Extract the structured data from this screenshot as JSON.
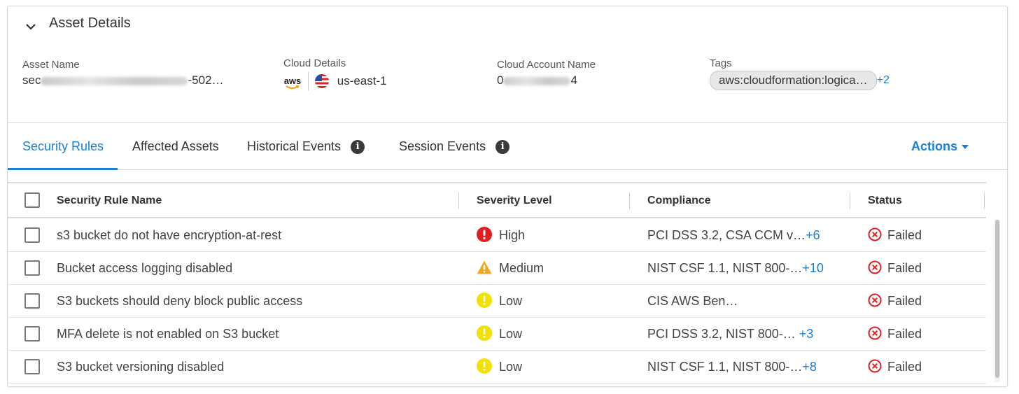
{
  "header": {
    "title": "Asset Details",
    "collapse_icon": "chevron-down-icon"
  },
  "details": {
    "asset_name": {
      "label": "Asset Name",
      "value_prefix": "sec",
      "value_suffix": "-502…"
    },
    "cloud_details": {
      "label": "Cloud Details",
      "provider": "aws",
      "region": "us-east-1"
    },
    "cloud_account_name": {
      "label": "Cloud Account Name",
      "value_prefix": "0",
      "value_suffix": "4"
    },
    "tags": {
      "label": "Tags",
      "pill": "aws:cloudformation:logica…",
      "more": "+2"
    }
  },
  "tabs": [
    {
      "label": "Security Rules",
      "active": true
    },
    {
      "label": "Affected Assets",
      "active": false
    },
    {
      "label": "Historical Events",
      "active": false,
      "info": "i"
    },
    {
      "label": "Session Events",
      "active": false,
      "info": "i"
    }
  ],
  "actions_label": "Actions",
  "table": {
    "columns": [
      "Security Rule Name",
      "Severity Level",
      "Compliance",
      "Status"
    ],
    "rows": [
      {
        "name": "s3 bucket do not have encryption-at-rest",
        "severity": "High",
        "severity_icon": "error-circle-icon",
        "compliance": "PCI DSS 3.2, CSA CCM v…",
        "more": "+6",
        "status": "Failed"
      },
      {
        "name": "Bucket access logging disabled",
        "severity": "Medium",
        "severity_icon": "warning-triangle-icon",
        "compliance": "NIST CSF 1.1, NIST 800-…",
        "more": "+10",
        "status": "Failed"
      },
      {
        "name": "S3 buckets should deny block public access",
        "severity": "Low",
        "severity_icon": "alert-circle-icon",
        "compliance": "CIS AWS Ben…",
        "more": "",
        "status": "Failed"
      },
      {
        "name": "MFA delete is not enabled on S3 bucket",
        "severity": "Low",
        "severity_icon": "alert-circle-icon",
        "compliance": "PCI DSS 3.2, NIST 800-…",
        "more": "+3",
        "status": "Failed"
      },
      {
        "name": "S3 bucket versioning disabled",
        "severity": "Low",
        "severity_icon": "alert-circle-icon",
        "compliance": "NIST CSF 1.1, NIST 800-…",
        "more": "+8",
        "status": "Failed"
      }
    ]
  },
  "colors": {
    "accent": "#1a7fd4",
    "high": "#e02020",
    "medium": "#f5a623",
    "low": "#f2e200",
    "failed": "#e02020"
  }
}
